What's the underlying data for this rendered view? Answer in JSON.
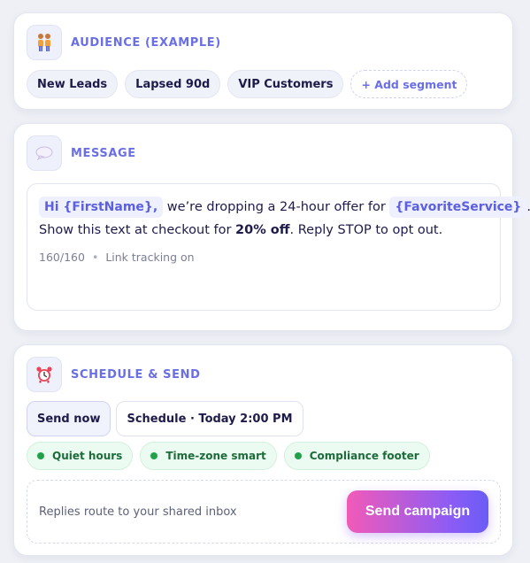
{
  "audience": {
    "title": "AUDIENCE (EXAMPLE)",
    "icon": "people-icon",
    "segments": [
      "New Leads",
      "Lapsed 90d",
      "VIP Customers"
    ],
    "add_label": "+ Add segment"
  },
  "message": {
    "title": "MESSAGE",
    "icon": "speech-bubble-icon",
    "token_first_name": "Hi {FirstName},",
    "text_part1": "we’re dropping a 24-hour offer for",
    "token_service": "{FavoriteService}",
    "text_part2": ".",
    "line2_prefix": "Show this text at checkout for",
    "line2_bold": "20% off",
    "line2_suffix": ". Reply STOP to opt out.",
    "char_count": "160/160",
    "tracking": "Link tracking on"
  },
  "schedule": {
    "title": "SCHEDULE & SEND",
    "icon": "alarm-clock-icon",
    "send_now": "Send now",
    "schedule_label": "Schedule · Today 2:00 PM",
    "tags": [
      "Quiet hours",
      "Time-zone smart",
      "Compliance footer"
    ],
    "reply_note": "Replies route to your shared inbox",
    "send_button": "Send campaign"
  },
  "colors": {
    "accent": "#6a6fe6",
    "tag_green": "#22a04a",
    "gradient_start": "#f25ab8",
    "gradient_end": "#6a5cf5"
  }
}
